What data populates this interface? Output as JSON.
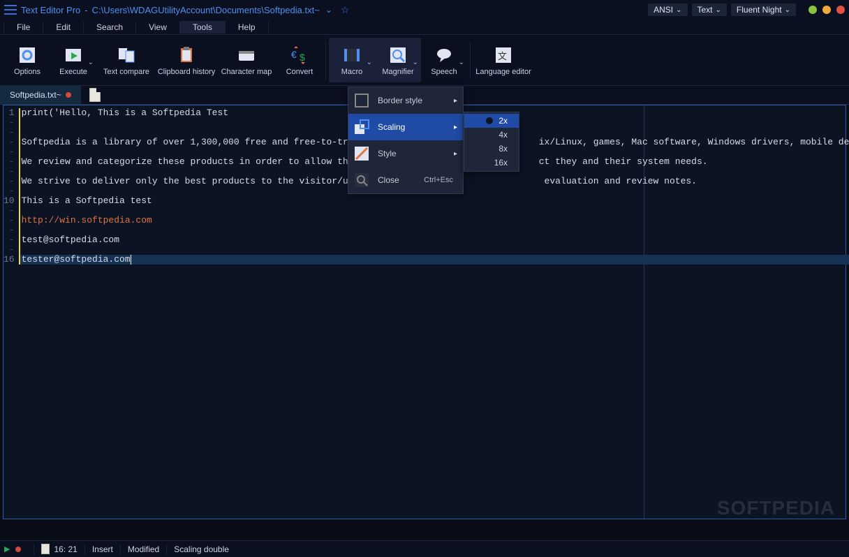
{
  "titlebar": {
    "app_name": "Text Editor Pro",
    "separator": "-",
    "path": "C:\\Users\\WDAGUtilityAccount\\Documents\\Softpedia.txt~",
    "dropdowns": {
      "encoding": "ANSI",
      "mode": "Text",
      "theme": "Fluent Night"
    }
  },
  "menubar": [
    "File",
    "Edit",
    "Search",
    "View",
    "Tools",
    "Help"
  ],
  "menubar_active": "Tools",
  "ribbon": [
    {
      "label": "Options",
      "icon": "options"
    },
    {
      "label": "Execute",
      "icon": "execute",
      "caret": true
    },
    {
      "label": "Text compare",
      "icon": "compare"
    },
    {
      "label": "Clipboard history",
      "icon": "clipboard"
    },
    {
      "label": "Character map",
      "icon": "charmap"
    },
    {
      "label": "Convert",
      "icon": "convert"
    },
    {
      "label": "Macro",
      "icon": "macro",
      "caret": true,
      "group": "hl"
    },
    {
      "label": "Magnifier",
      "icon": "magnifier",
      "caret": true,
      "group": "hl"
    },
    {
      "label": "Speech",
      "icon": "speech",
      "caret": true
    },
    {
      "label": "Language editor",
      "icon": "lang"
    }
  ],
  "tab": {
    "name": "Softpedia.txt~",
    "modified": true
  },
  "gutter_lines": [
    "1",
    "-",
    "-",
    "-",
    "-",
    "-",
    "-",
    "-",
    "-",
    "10",
    "-",
    "-",
    "-",
    "-",
    "-",
    "16"
  ],
  "code_lines": [
    {
      "t": "print('Hello, This is a Softpedia Test"
    },
    {
      "t": ""
    },
    {
      "t": ""
    },
    {
      "t": "Softpedia is a library of over 1,300,000 free and free-to-try s                                ix/Linux, games, Mac software, Windows drivers, mobile devices and "
    },
    {
      "t": ""
    },
    {
      "t": "We review and categorize these products in order to allow the v                                ct they and their system needs."
    },
    {
      "t": ""
    },
    {
      "t": "We strive to deliver only the best products to the visitor/user                                 evaluation and review notes."
    },
    {
      "t": ""
    },
    {
      "t": "This is a Softpedia test"
    },
    {
      "t": ""
    },
    {
      "t": "http://win.softpedia.com",
      "url": true
    },
    {
      "t": ""
    },
    {
      "t": "test@softpedia.com"
    },
    {
      "t": ""
    },
    {
      "t": "tester@softpedia.com",
      "cursor": true
    }
  ],
  "magnifier_menu": {
    "items": [
      {
        "label": "Border style",
        "icon": "border",
        "arrow": true
      },
      {
        "label": "Scaling",
        "icon": "scaling",
        "arrow": true,
        "highlight": true
      },
      {
        "label": "Style",
        "icon": "style",
        "arrow": true
      },
      {
        "label": "Close",
        "icon": "close-magnifier",
        "shortcut": "Ctrl+Esc"
      }
    ],
    "scaling_options": [
      "2x",
      "4x",
      "8x",
      "16x"
    ],
    "scaling_selected": "2x"
  },
  "statusbar": {
    "cursor": "16: 21",
    "mode": "Insert",
    "state": "Modified",
    "scaling": "Scaling double"
  },
  "watermark": "SOFTPEDIA"
}
